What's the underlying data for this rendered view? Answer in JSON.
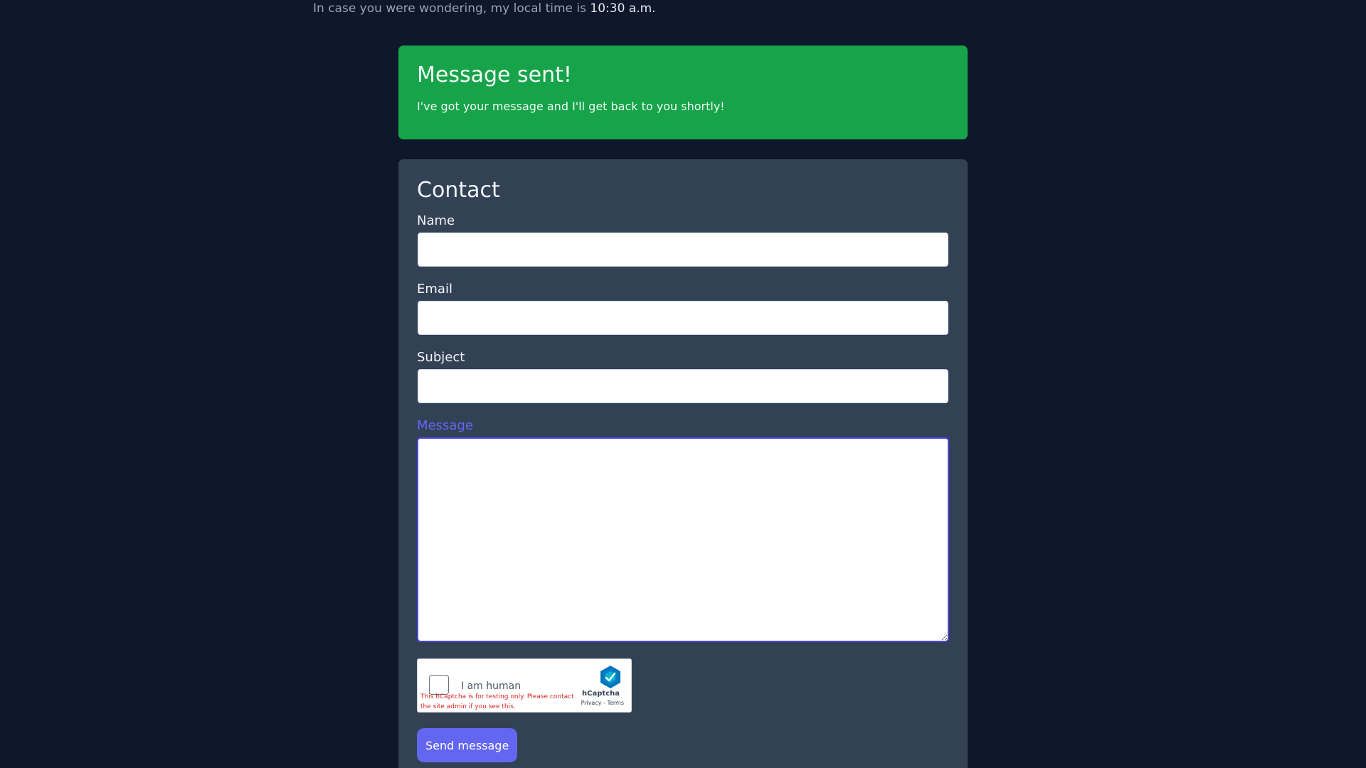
{
  "local_time": {
    "prefix": "In case you were wondering, my local time is ",
    "time": "10:30 a.m."
  },
  "alert": {
    "title": "Message sent!",
    "message": "I've got your message and I'll get back to you shortly!"
  },
  "contact": {
    "title": "Contact",
    "name_label": "Name",
    "name_value": "",
    "email_label": "Email",
    "email_value": "",
    "subject_label": "Subject",
    "subject_value": "",
    "message_label": "Message",
    "message_value": "",
    "send_label": "Send message"
  },
  "captcha": {
    "label": "I am human",
    "warning": "This hCaptcha is for testing only. Please contact the site admin if you see this.",
    "brand": "hCaptcha",
    "links": "Privacy - Terms",
    "icon": "hcaptcha-logo-icon"
  },
  "colors": {
    "background": "#0f172a",
    "card": "#334155",
    "success": "#16a34a",
    "accent": "#6366f1"
  }
}
